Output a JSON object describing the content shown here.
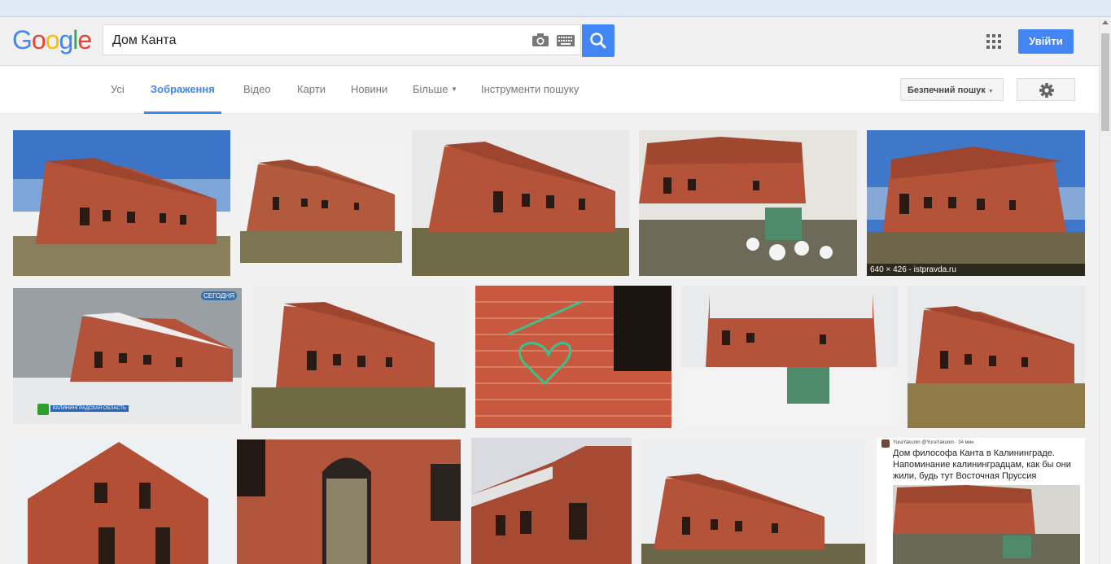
{
  "logo": "Google",
  "search": {
    "value": "Дом Канта"
  },
  "header": {
    "signin_label": "Увійти"
  },
  "tabs": [
    {
      "label": "Усі"
    },
    {
      "label": "Зображення"
    },
    {
      "label": "Відео"
    },
    {
      "label": "Карти"
    },
    {
      "label": "Новини"
    },
    {
      "label": "Більше"
    },
    {
      "label": "Інструменти пошуку"
    }
  ],
  "safe_search_label": "Безпечний пошук",
  "colors": {
    "accent": "#4285f4",
    "brick": "#b5533a",
    "roof": "#a0482f"
  },
  "results": [
    {
      "id": "r1",
      "caption": ""
    },
    {
      "id": "r2",
      "caption": ""
    },
    {
      "id": "r3",
      "caption": ""
    },
    {
      "id": "r4",
      "caption": ""
    },
    {
      "id": "r5",
      "caption": "640 × 426 - istpravda.ru"
    },
    {
      "id": "r6",
      "badge": "СЕГОДНЯ",
      "sub": "КАЛИНИНГРАДСКАЯ ОБЛАСТЬ"
    },
    {
      "id": "r7"
    },
    {
      "id": "r8"
    },
    {
      "id": "r9"
    },
    {
      "id": "r10"
    },
    {
      "id": "r11"
    },
    {
      "id": "r12"
    },
    {
      "id": "r13"
    },
    {
      "id": "r14"
    },
    {
      "id": "r15",
      "tweet_user": "YuraYakunin @YuraYakunin · 34 мин",
      "tweet_text": "Дом философа Канта в Калининграде. Напоминание калининградцам, как бы они жили, будь тут Восточная Пруссия"
    }
  ]
}
